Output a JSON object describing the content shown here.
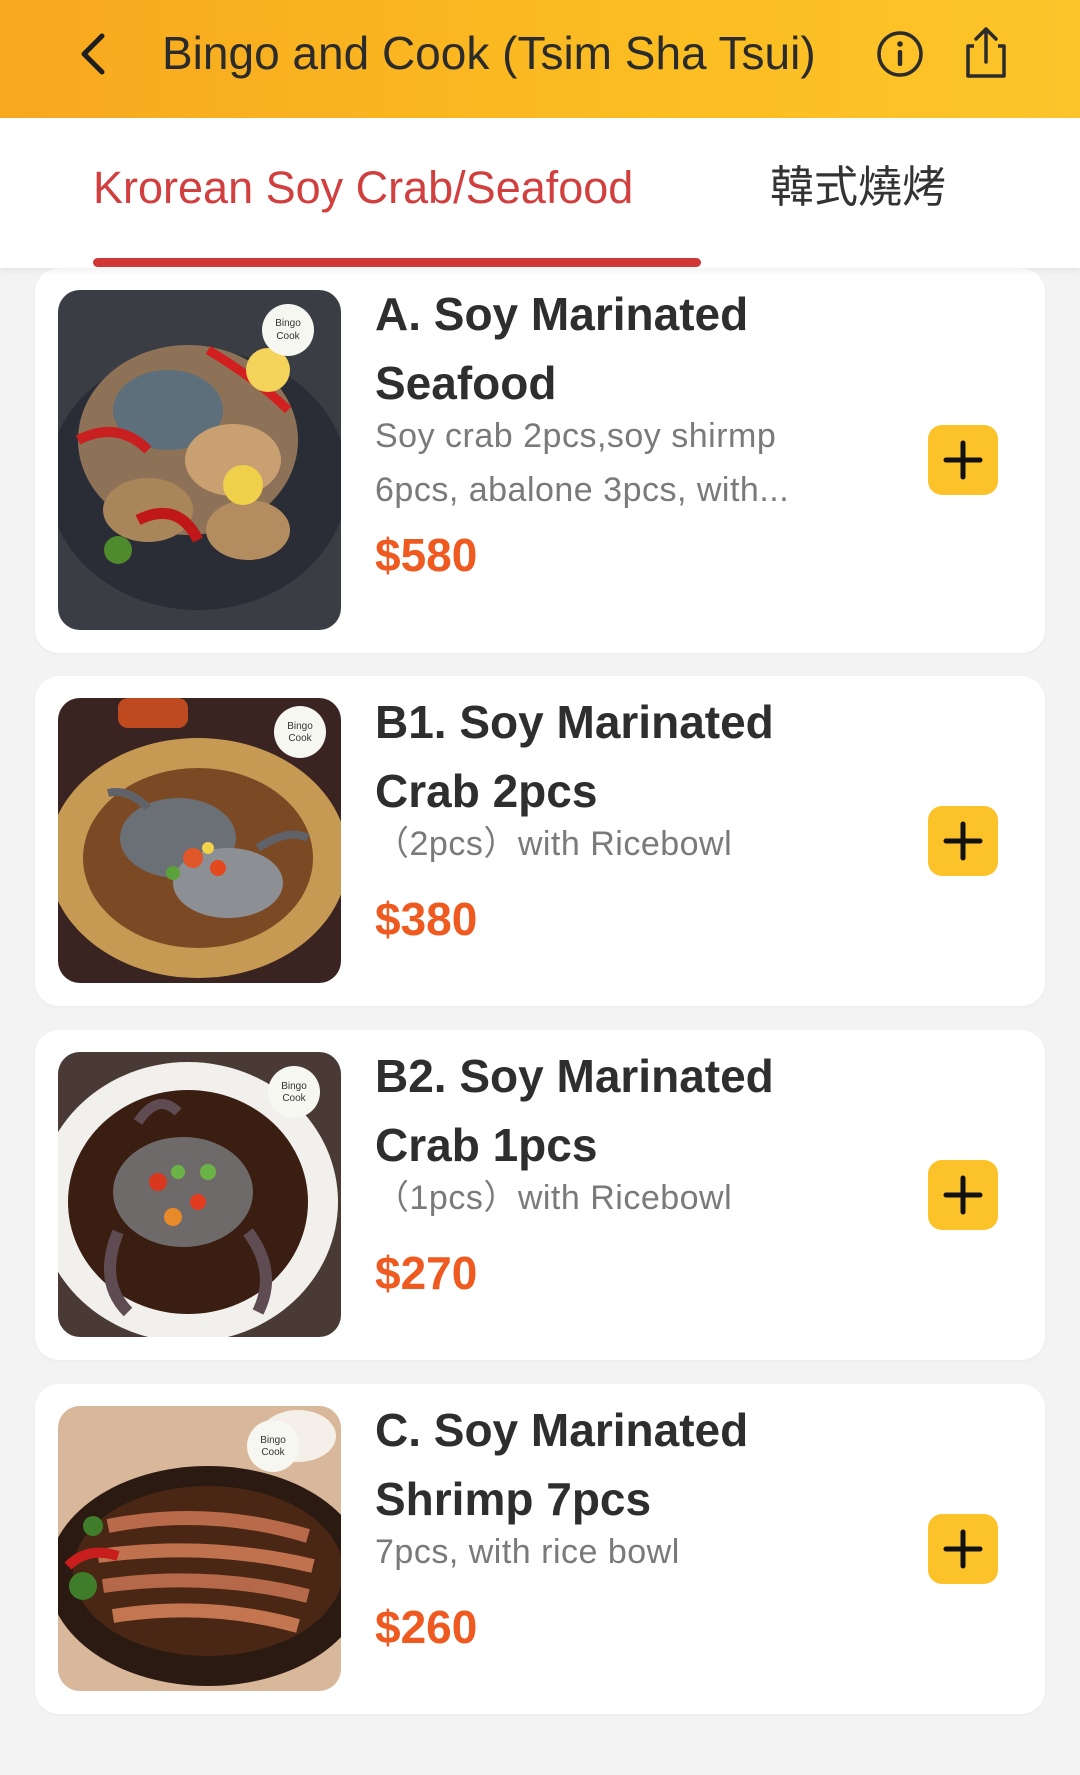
{
  "header": {
    "title": "Bingo and Cook (Tsim Sha Tsui)",
    "background": "#fbb622"
  },
  "tabs": [
    {
      "label": "Krorean Soy Crab/Seafood",
      "active": true
    },
    {
      "label": "韓式燒烤",
      "active": false
    }
  ],
  "colors": {
    "accent_red": "#d23f3f",
    "price": "#ee5a1f",
    "add_button": "#fcc22a"
  },
  "items": [
    {
      "name": "A. Soy Marinated Seafood",
      "desc": "Soy crab 2pcs,soy shirmp 6pcs, abalone 3pcs, with...",
      "price": "$580",
      "image_logo": "Bingo Cook"
    },
    {
      "name": "B1. Soy Marinated Crab 2pcs",
      "desc": "（2pcs）with Ricebowl",
      "price": "$380",
      "image_logo": "Bingo Cook"
    },
    {
      "name": "B2. Soy Marinated Crab 1pcs",
      "desc": "（1pcs）with Ricebowl",
      "price": "$270",
      "image_logo": "Bingo Cook"
    },
    {
      "name": "C. Soy Marinated Shrimp 7pcs",
      "desc": "7pcs, with rice bowl",
      "price": "$260",
      "image_logo": "Bingo Cook"
    }
  ],
  "icons": {
    "back": "chevron-left-icon",
    "info": "info-icon",
    "share": "share-icon",
    "add": "plus-icon"
  }
}
